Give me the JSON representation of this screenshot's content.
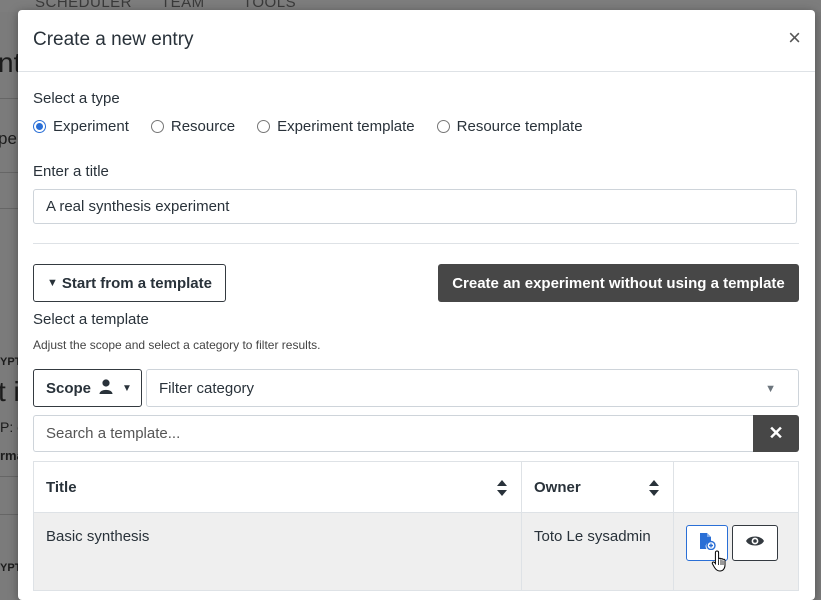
{
  "background": {
    "nav_items": [
      "SCHEDULER",
      "TEAM",
      "TOOLS"
    ],
    "fragments": [
      "nt",
      "pe",
      "YPT",
      "t i",
      "P: e",
      "rma",
      "YPT"
    ]
  },
  "modal": {
    "title": "Create a new entry",
    "close_glyph": "×",
    "type_label": "Select a type",
    "types": [
      {
        "label": "Experiment",
        "checked": true
      },
      {
        "label": "Resource",
        "checked": false
      },
      {
        "label": "Experiment template",
        "checked": false
      },
      {
        "label": "Resource template",
        "checked": false
      }
    ],
    "title_label": "Enter a title",
    "title_value": "A real synthesis experiment",
    "start_template_label": "Start from a template",
    "no_template_label": "Create an experiment without using a template",
    "select_template_label": "Select a template",
    "hint": "Adjust the scope and select a category to filter results.",
    "scope_label": "Scope",
    "filter_placeholder": "Filter category",
    "search_placeholder": "Search a template...",
    "table": {
      "headers": [
        "Title",
        "Owner"
      ],
      "rows": [
        {
          "title": "Basic synthesis",
          "owner": "Toto Le sysadmin"
        }
      ]
    }
  },
  "colors": {
    "primary": "#2a6fd6",
    "dark_button": "#474747",
    "overlay": "#7b7b7b"
  }
}
